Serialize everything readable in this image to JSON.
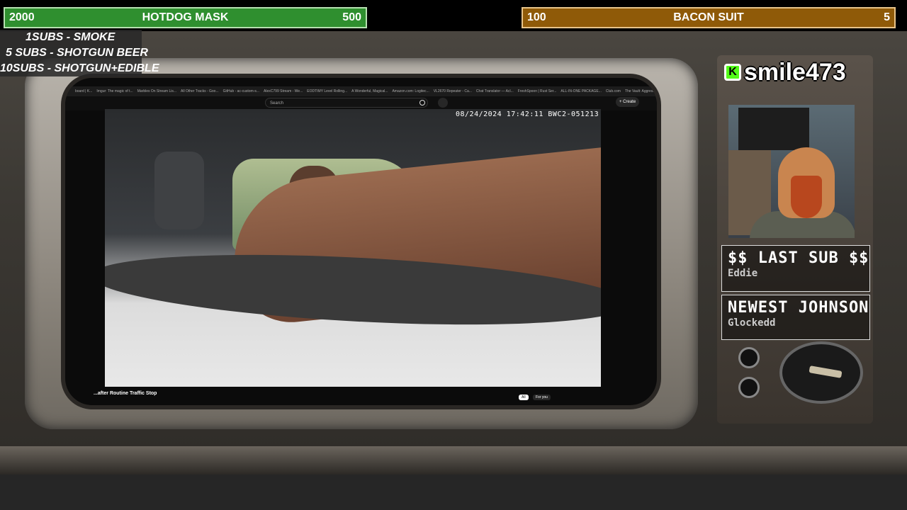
{
  "goals": {
    "left": {
      "current": "2000",
      "title": "HOTDOG MASK",
      "target": "500"
    },
    "right": {
      "current": "100",
      "title": "BACON SUIT",
      "target": "5"
    }
  },
  "sub_menu": [
    "1SUBS   - SMOKE",
    "5 SUBS  - SHOTGUN BEER",
    "10SUBS - SHOTGUN+EDIBLE"
  ],
  "browser": {
    "tabs": [
      "board | K...",
      "Imgur: The magic of t...",
      "Marbles On Stream Lis...",
      "All Other Tracks - Goo...",
      "GitHub - ac-custom-s...",
      "AlexC799 Stream - We...",
      "EODTIMY Level Rolling...",
      "A Wonderful, Magical...",
      "Amazon.com: Logitec...",
      "VL2670 Repeater - Ca...",
      "Chat Translator — Acl...",
      "FreshSpoon | Rust Ser...",
      "ALL-IN-ONE PACKAGE...",
      "Club.com",
      "The Vault: Aggressive I..."
    ],
    "search_placeholder": "Search",
    "create_label": "Create"
  },
  "video": {
    "timestamp": "08/24/2024 17:42:11   BWC2-051213",
    "title": "...after Routine Traffic Stop",
    "chips": [
      "All",
      "For you"
    ]
  },
  "channel": {
    "platform_badge": "K",
    "name": "smile473"
  },
  "last_sub": {
    "label": "$$ LAST SUB $$",
    "value": "Eddie"
  },
  "newest_johnson": {
    "label": "NEWEST JOHNSON",
    "value": "Glockedd"
  },
  "colors": {
    "goal_left": "#2f8f2f",
    "goal_right": "#8f5a08",
    "kick_green": "#53fc18"
  }
}
